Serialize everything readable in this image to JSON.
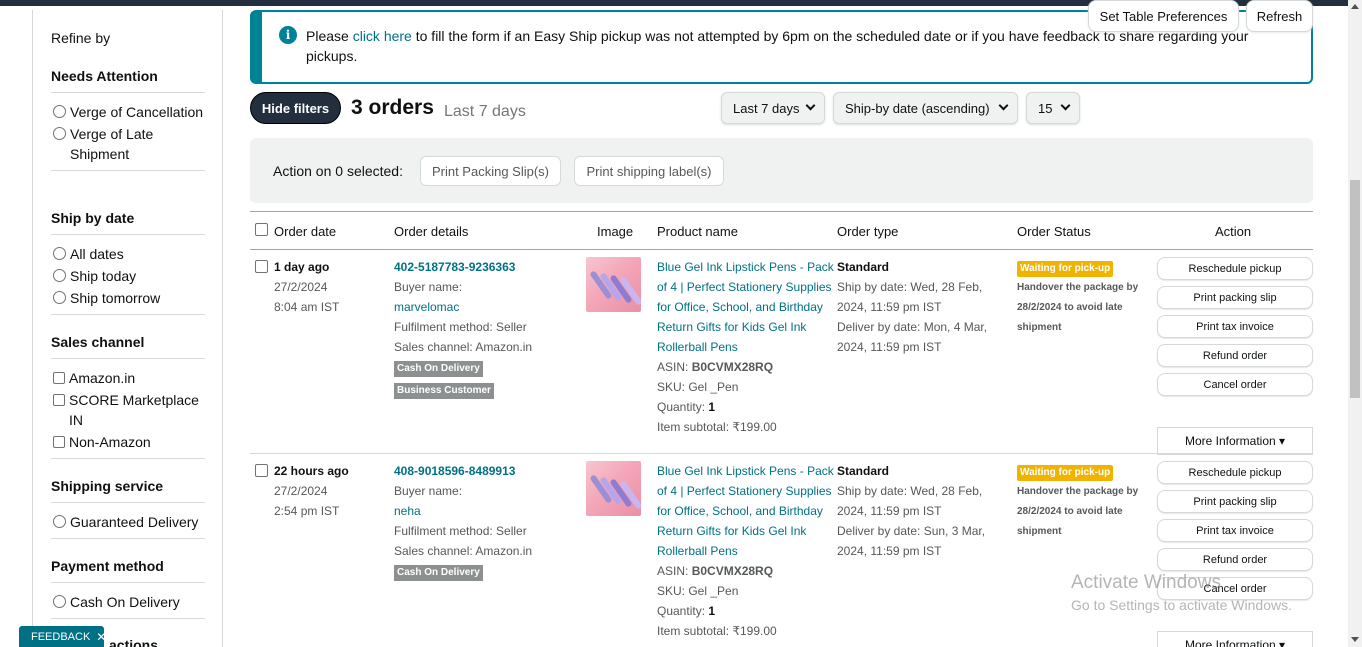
{
  "sidebar": {
    "refine_label": "Refine by",
    "needs_attention": {
      "title": "Needs Attention",
      "options": [
        "Verge of Cancellation",
        "Verge of Late Shipment"
      ]
    },
    "ship_by_date": {
      "title": "Ship by date",
      "options": [
        "All dates",
        "Ship today",
        "Ship tomorrow"
      ]
    },
    "sales_channel": {
      "title": "Sales channel",
      "options": [
        "Amazon.in",
        "SCORE Marketplace IN",
        "Non-Amazon"
      ]
    },
    "shipping_service": {
      "title": "Shipping service",
      "options": [
        "Guaranteed Delivery"
      ]
    },
    "payment_method": {
      "title": "Payment method",
      "options": [
        "Cash On Delivery"
      ]
    },
    "next_section_partial": "actions"
  },
  "feedback": {
    "label": "FEEDBACK",
    "close": "✕"
  },
  "banner": {
    "icon": "info-icon",
    "prefix": "Please ",
    "link": "click here",
    "suffix": " to fill the form if an Easy Ship pickup was not attempted by 6pm on the scheduled date or if you have feedback to share regarding your pickups."
  },
  "toolbar": {
    "hide_filters": "Hide filters",
    "orders_count": "3 orders",
    "orders_range": "Last 7 days",
    "range_select": "Last 7 days",
    "sort_select": "Ship-by date (ascending)",
    "page_size_select": "15",
    "table_prefs": "Set Table Preferences",
    "refresh": "Refresh"
  },
  "action_bar": {
    "label": "Action on 0 selected:",
    "print_packing": "Print Packing Slip(s)",
    "print_shipping": "Print shipping label(s)"
  },
  "table": {
    "headers": [
      "Order date",
      "Order details",
      "Image",
      "Product name",
      "Order type",
      "Order Status",
      "Action"
    ],
    "rows": [
      {
        "date_ago": "1 day ago",
        "date": "27/2/2024",
        "time": "8:04 am IST",
        "order_id": "402-5187783-9236363",
        "buyer_label": "Buyer name:",
        "buyer": "marvelomac",
        "fulfilment": "Fulfilment method: Seller",
        "channel": "Sales channel: Amazon.in",
        "tags": [
          "Cash On Delivery",
          "Business Customer"
        ],
        "product_name": "Blue Gel Ink Lipstick Pens - Pack of 4 | Perfect Stationery Supplies for Office, School, and Birthday Return Gifts for Kids Gel Ink Rollerball Pens",
        "asin_label": "ASIN: ",
        "asin": "B0CVMX28RQ",
        "sku": "SKU: Gel _Pen",
        "qty_label": "Quantity: ",
        "qty": "1",
        "subtotal": "Item subtotal: ₹199.00",
        "order_type": "Standard",
        "ship_by": "Ship by date: Wed, 28 Feb, 2024, 11:59 pm IST",
        "deliver_by": "Deliver by date: Mon, 4 Mar, 2024, 11:59 pm IST",
        "status": "Waiting for pick-up",
        "handover": "Handover the package by 28/2/2024 to avoid late shipment",
        "actions": [
          "Reschedule pickup",
          "Print packing slip",
          "Print tax invoice",
          "Refund order",
          "Cancel order"
        ],
        "more": "More Information ▾"
      },
      {
        "date_ago": "22 hours ago",
        "date": "27/2/2024",
        "time": "2:54 pm IST",
        "order_id": "408-9018596-8489913",
        "buyer_label": "Buyer name:",
        "buyer": "neha",
        "fulfilment": "Fulfilment method: Seller",
        "channel": "Sales channel: Amazon.in",
        "tags": [
          "Cash On Delivery"
        ],
        "product_name": "Blue Gel Ink Lipstick Pens - Pack of 4 | Perfect Stationery Supplies for Office, School, and Birthday Return Gifts for Kids Gel Ink Rollerball Pens",
        "asin_label": "ASIN: ",
        "asin": "B0CVMX28RQ",
        "sku": "SKU: Gel _Pen",
        "qty_label": "Quantity: ",
        "qty": "1",
        "subtotal": "Item subtotal: ₹199.00",
        "order_type": "Standard",
        "ship_by": "Ship by date: Wed, 28 Feb, 2024, 11:59 pm IST",
        "deliver_by": "Deliver by date: Sun, 3 Mar, 2024, 11:59 pm IST",
        "status": "Waiting for pick-up",
        "handover": "Handover the package by 28/2/2024 to avoid late shipment",
        "actions": [
          "Reschedule pickup",
          "Print packing slip",
          "Print tax invoice",
          "Refund order",
          "Cancel order"
        ],
        "more": "More Information ▾"
      }
    ]
  },
  "watermark": {
    "line1": "Activate Windows",
    "line2": "Go to Settings to activate Windows."
  },
  "colors": {
    "accent": "#008296",
    "link": "#007185",
    "status": "#f0b400",
    "dark": "#232f3e"
  }
}
